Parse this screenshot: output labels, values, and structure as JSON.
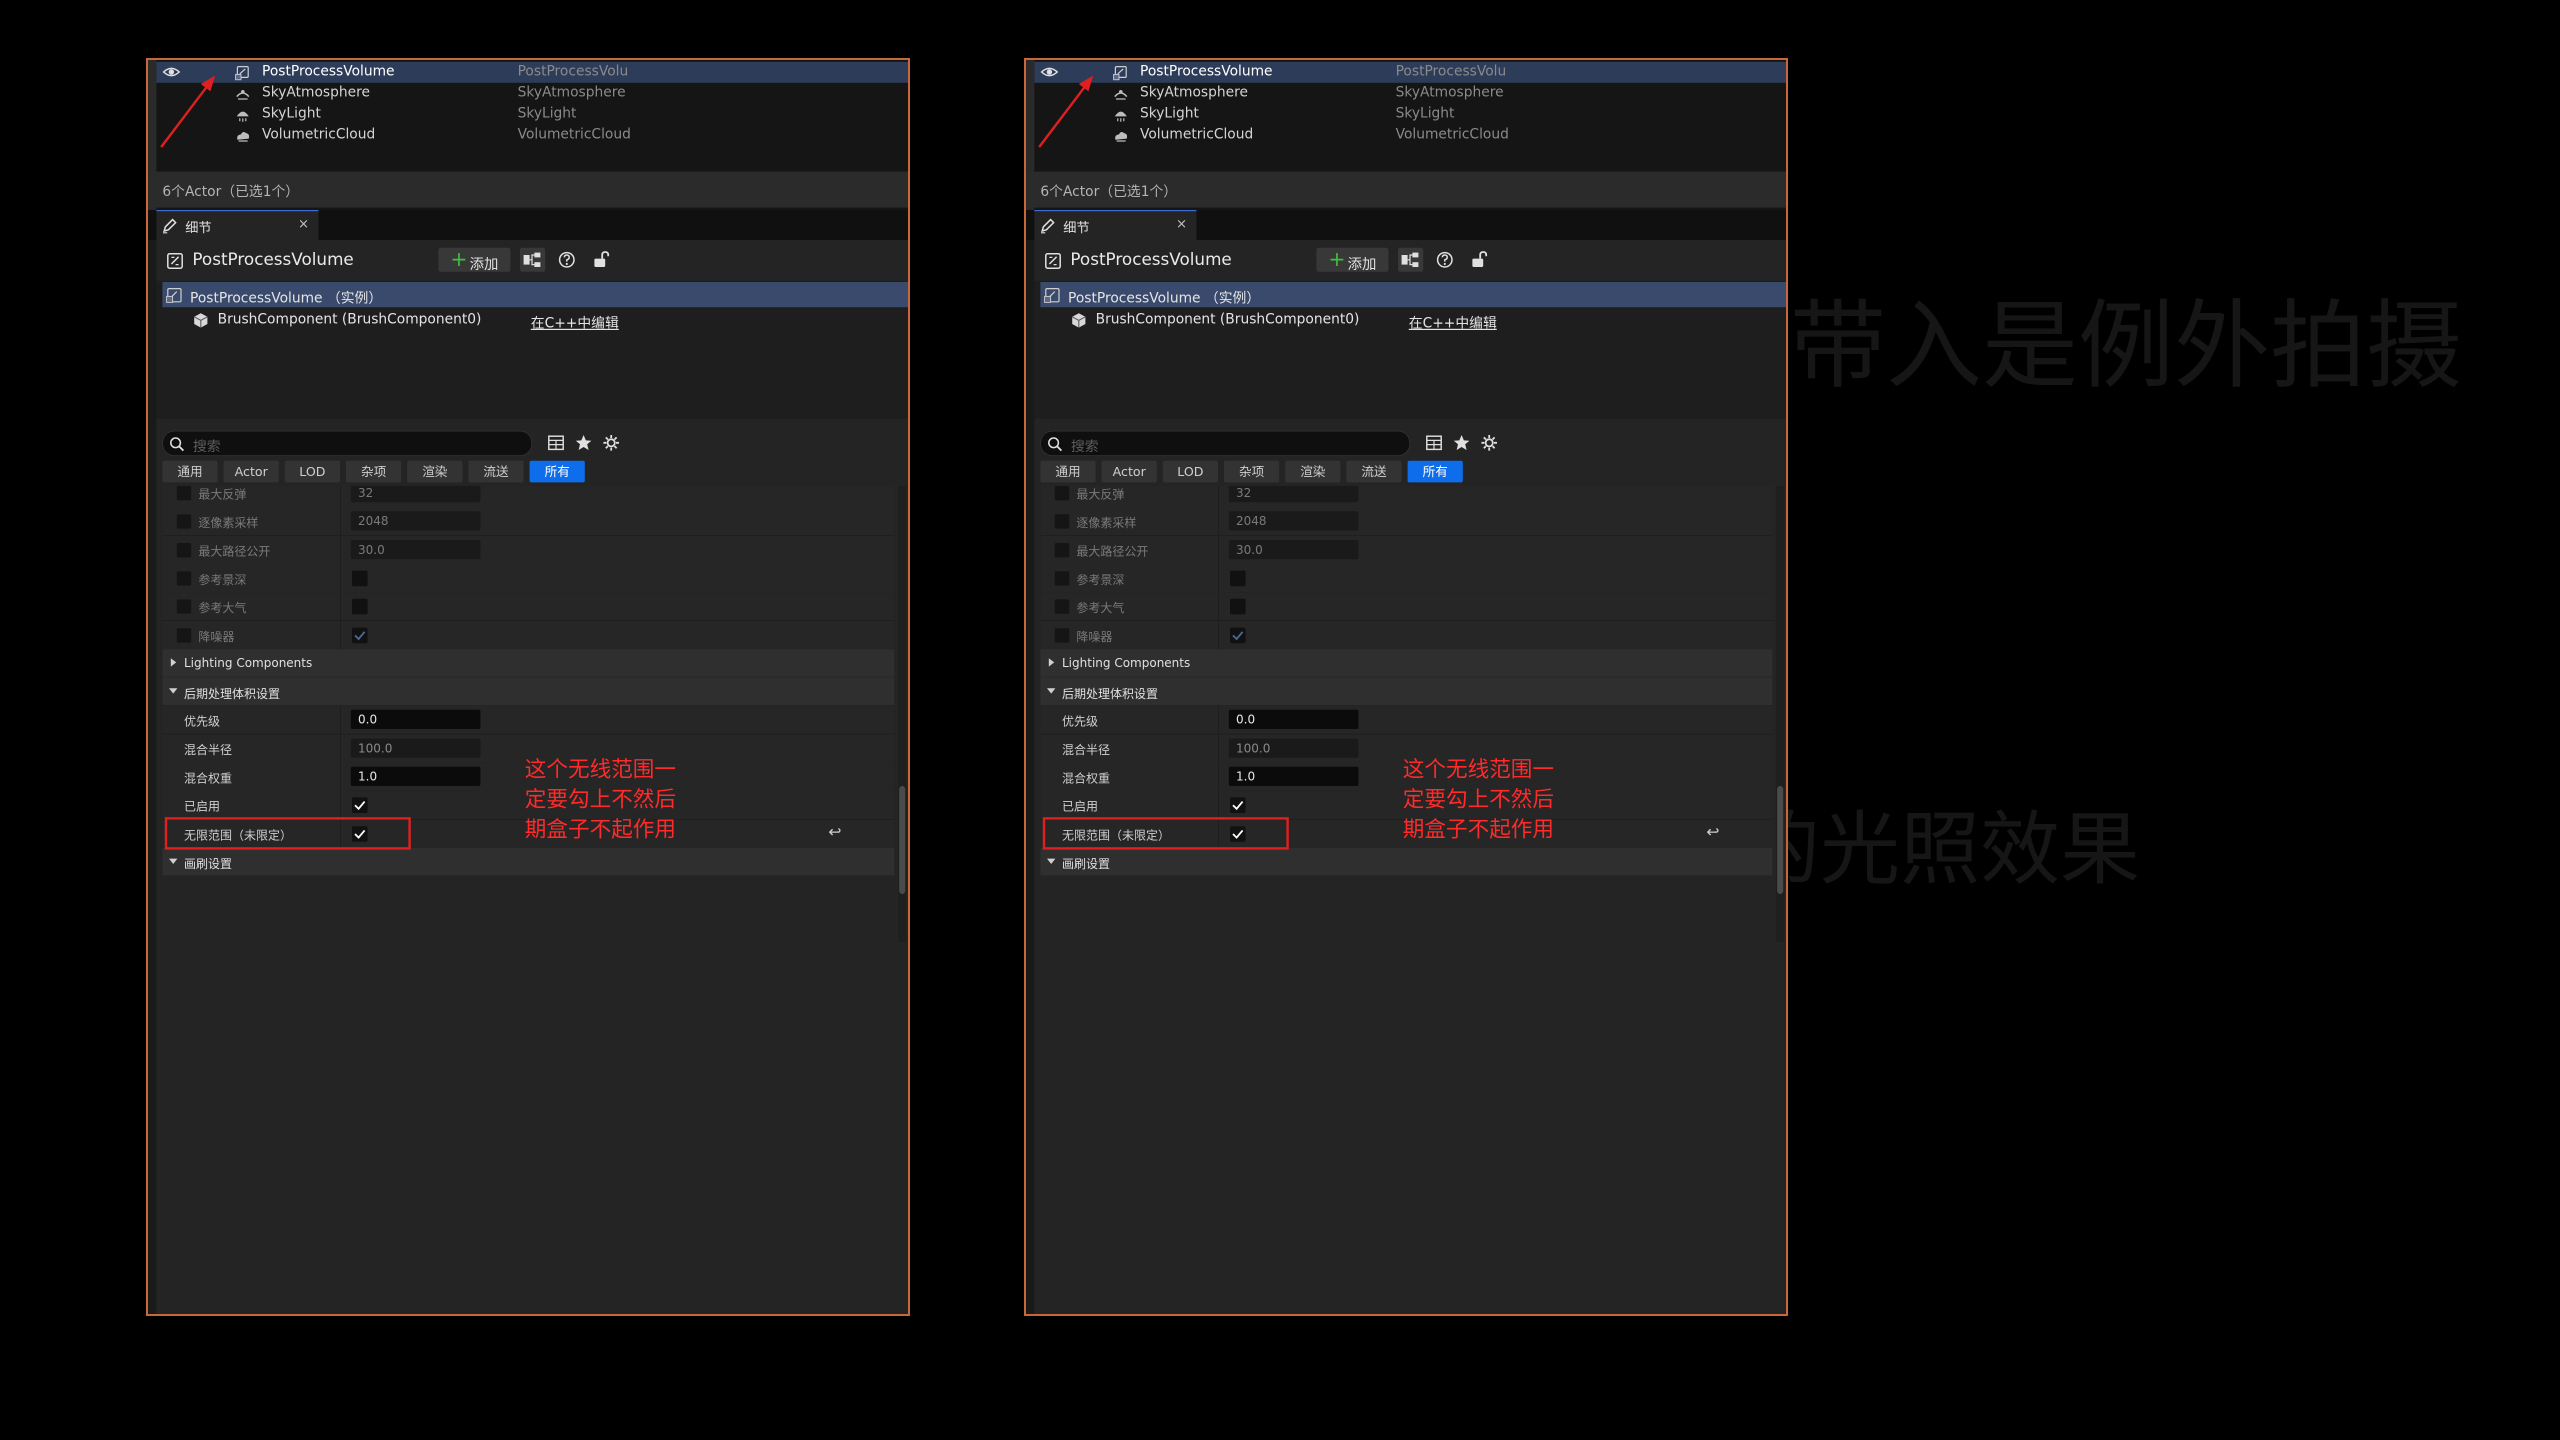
{
  "background": {
    "color": "#000000",
    "ghost_lines": [
      "带入是例外拍摄",
      "的场景动态化表的光照效果"
    ]
  },
  "colors": {
    "panel_border": "#c8673a",
    "selection": "#2d3c59",
    "accent_blue": "#0d6dea",
    "add_green": "#3fbf3f",
    "annotation_red": "#ff2a2a"
  },
  "panels": [
    {
      "outliner": {
        "items": [
          {
            "name": "PostProcessVolume",
            "type": "PostProcessVolu",
            "icon": "post-process-volume-icon",
            "selected": true
          },
          {
            "name": "SkyAtmosphere",
            "type": "SkyAtmosphere",
            "icon": "sky-atmosphere-icon",
            "selected": false
          },
          {
            "name": "SkyLight",
            "type": "SkyLight",
            "icon": "sky-light-icon",
            "selected": false
          },
          {
            "name": "VolumetricCloud",
            "type": "VolumetricCloud",
            "icon": "volumetric-cloud-icon",
            "selected": false
          }
        ],
        "actor_count": "6个Actor（已选1个）"
      },
      "details_tab": {
        "label": "细节",
        "close": "×"
      },
      "details": {
        "title": "PostProcessVolume",
        "add_label": "添加",
        "components": [
          {
            "label": "PostProcessVolume （实例）",
            "selected": true
          },
          {
            "label": "BrushComponent (BrushComponent0)",
            "link": "在C++中编辑"
          }
        ],
        "search_placeholder": "搜索",
        "filters": [
          "通用",
          "Actor",
          "LOD",
          "杂项",
          "渲染",
          "流送",
          "所有"
        ],
        "active_filter": "所有",
        "properties": [
          {
            "label": "最大反弹",
            "value": "32",
            "kind": "text",
            "dim": true
          },
          {
            "label": "逐像素采样",
            "value": "2048",
            "kind": "text",
            "dim": true
          },
          {
            "label": "最大路径公开",
            "value": "30.0",
            "kind": "text",
            "dim": true
          },
          {
            "label": "参考景深",
            "value": "",
            "kind": "check",
            "checked": false,
            "dim": true
          },
          {
            "label": "参考大气",
            "value": "",
            "kind": "check",
            "checked": false,
            "dim": true
          },
          {
            "label": "降噪器",
            "value": "",
            "kind": "check",
            "checked": true,
            "dim": true
          },
          {
            "label": "Lighting Components",
            "kind": "category",
            "expanded": false
          },
          {
            "label": "后期处理体积设置",
            "kind": "category",
            "expanded": true
          },
          {
            "label": "优先级",
            "value": "0.0",
            "kind": "text"
          },
          {
            "label": "混合半径",
            "value": "100.0",
            "kind": "text",
            "muted": true
          },
          {
            "label": "混合权重",
            "value": "1.0",
            "kind": "text"
          },
          {
            "label": "已启用",
            "value": "",
            "kind": "check",
            "checked": true
          },
          {
            "label": "无限范围（未限定）",
            "value": "",
            "kind": "check",
            "checked": true,
            "highlight": true
          },
          {
            "label": "画刷设置",
            "kind": "category",
            "expanded": true
          }
        ],
        "annotation": [
          "这个无线范围一",
          "定要勾上不然后",
          "期盒子不起作用"
        ],
        "reset_icon": "↩"
      }
    },
    {
      "outliner": {
        "items": [
          {
            "name": "PostProcessVolume",
            "type": "PostProcessVolu",
            "icon": "post-process-volume-icon",
            "selected": true
          },
          {
            "name": "SkyAtmosphere",
            "type": "SkyAtmosphere",
            "icon": "sky-atmosphere-icon",
            "selected": false
          },
          {
            "name": "SkyLight",
            "type": "SkyLight",
            "icon": "sky-light-icon",
            "selected": false
          },
          {
            "name": "VolumetricCloud",
            "type": "VolumetricCloud",
            "icon": "volumetric-cloud-icon",
            "selected": false
          }
        ],
        "actor_count": "6个Actor（已选1个）"
      },
      "details_tab": {
        "label": "细节",
        "close": "×"
      },
      "details": {
        "title": "PostProcessVolume",
        "add_label": "添加",
        "components": [
          {
            "label": "PostProcessVolume （实例）",
            "selected": true
          },
          {
            "label": "BrushComponent (BrushComponent0)",
            "link": "在C++中编辑"
          }
        ],
        "search_placeholder": "搜索",
        "filters": [
          "通用",
          "Actor",
          "LOD",
          "杂项",
          "渲染",
          "流送",
          "所有"
        ],
        "active_filter": "所有",
        "properties": [
          {
            "label": "最大反弹",
            "value": "32",
            "kind": "text",
            "dim": true
          },
          {
            "label": "逐像素采样",
            "value": "2048",
            "kind": "text",
            "dim": true
          },
          {
            "label": "最大路径公开",
            "value": "30.0",
            "kind": "text",
            "dim": true
          },
          {
            "label": "参考景深",
            "value": "",
            "kind": "check",
            "checked": false,
            "dim": true
          },
          {
            "label": "参考大气",
            "value": "",
            "kind": "check",
            "checked": false,
            "dim": true
          },
          {
            "label": "降噪器",
            "value": "",
            "kind": "check",
            "checked": true,
            "dim": true
          },
          {
            "label": "Lighting Components",
            "kind": "category",
            "expanded": false
          },
          {
            "label": "后期处理体积设置",
            "kind": "category",
            "expanded": true
          },
          {
            "label": "优先级",
            "value": "0.0",
            "kind": "text"
          },
          {
            "label": "混合半径",
            "value": "100.0",
            "kind": "text",
            "muted": true
          },
          {
            "label": "混合权重",
            "value": "1.0",
            "kind": "text"
          },
          {
            "label": "已启用",
            "value": "",
            "kind": "check",
            "checked": true
          },
          {
            "label": "无限范围（未限定）",
            "value": "",
            "kind": "check",
            "checked": true,
            "highlight": true
          },
          {
            "label": "画刷设置",
            "kind": "category",
            "expanded": true
          }
        ],
        "annotation": [
          "这个无线范围一",
          "定要勾上不然后",
          "期盒子不起作用"
        ],
        "reset_icon": "↩"
      }
    }
  ]
}
